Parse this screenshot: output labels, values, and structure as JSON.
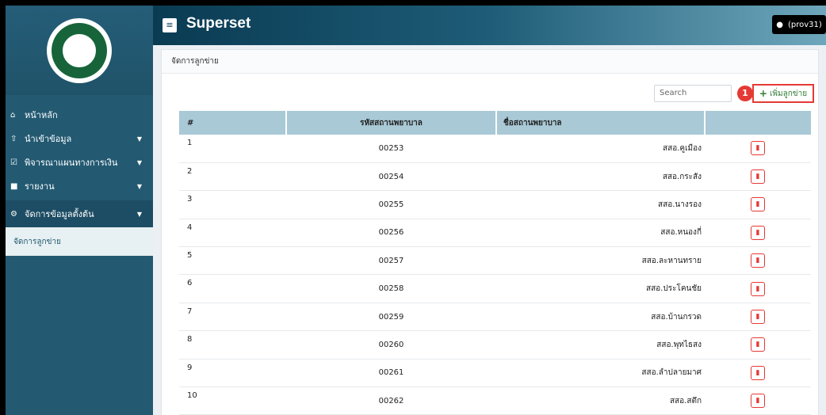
{
  "app": {
    "title": "Superset",
    "user": "(prov31)"
  },
  "sidebar": {
    "items": [
      {
        "label": "หน้าหลัก",
        "icon": "home-icon",
        "has_caret": false
      },
      {
        "label": "นำเข้าข้อมูล",
        "icon": "upload-icon",
        "has_caret": true
      },
      {
        "label": "พิจารณาแผนทางการเงิน",
        "icon": "check-square-icon",
        "has_caret": true
      },
      {
        "label": "รายงาน",
        "icon": "file-icon",
        "has_caret": true
      },
      {
        "label": "จัดการข้อมูลตั้งต้น",
        "icon": "gear-icon",
        "has_caret": true
      }
    ],
    "submenu": {
      "label": "จัดการลูกข่าย"
    }
  },
  "panel": {
    "title": "จัดการลูกข่าย",
    "search_placeholder": "Search",
    "add_button": "เพิ่มลูกข่าย",
    "annotation_number": "1"
  },
  "table": {
    "headers": [
      "#",
      "รหัสสถานพยาบาล",
      "ชื่อสถานพยาบาล",
      ""
    ],
    "rows": [
      {
        "n": "1",
        "code": "00253",
        "name": "สสอ.คูเมือง"
      },
      {
        "n": "2",
        "code": "00254",
        "name": "สสอ.กระสัง"
      },
      {
        "n": "3",
        "code": "00255",
        "name": "สสอ.นางรอง"
      },
      {
        "n": "4",
        "code": "00256",
        "name": "สสอ.หนองกี่"
      },
      {
        "n": "5",
        "code": "00257",
        "name": "สสอ.ละหานทราย"
      },
      {
        "n": "6",
        "code": "00258",
        "name": "สสอ.ประโคนชัย"
      },
      {
        "n": "7",
        "code": "00259",
        "name": "สสอ.บ้านกรวด"
      },
      {
        "n": "8",
        "code": "00260",
        "name": "สสอ.พุทไธสง"
      },
      {
        "n": "9",
        "code": "00261",
        "name": "สสอ.ลำปลายมาศ"
      },
      {
        "n": "10",
        "code": "00262",
        "name": "สสอ.สตึก"
      }
    ]
  },
  "colors": {
    "sidebar": "#235a72",
    "header_row": "#a9c9d6",
    "delete": "#e53935",
    "add": "#2e7d32"
  }
}
